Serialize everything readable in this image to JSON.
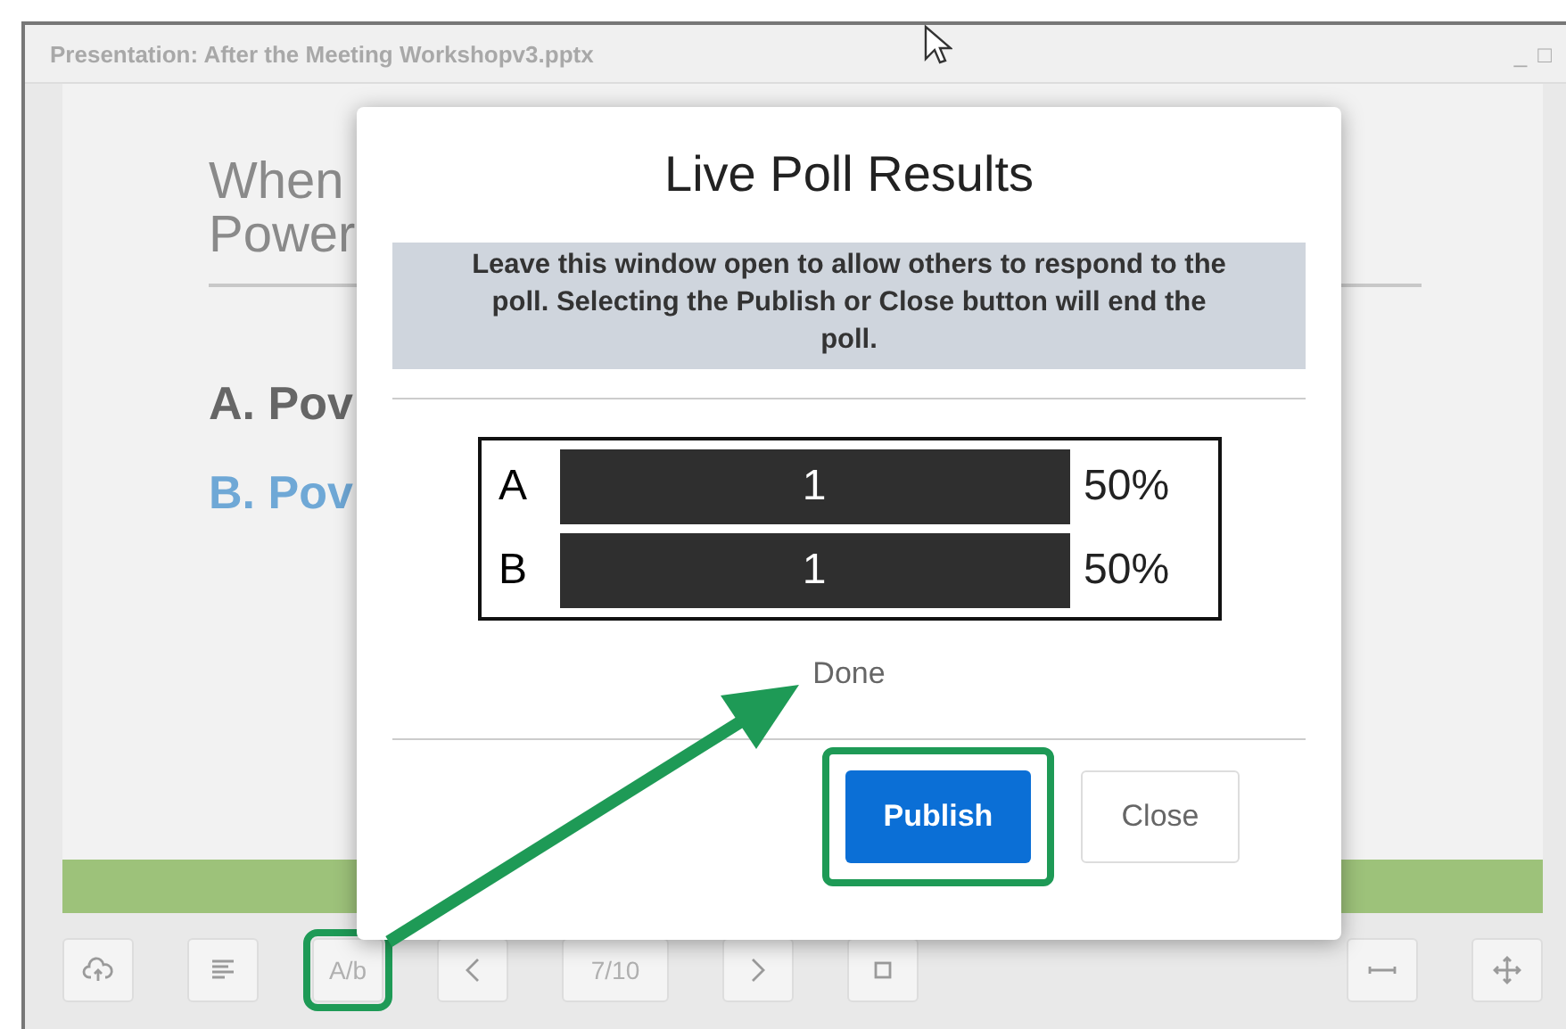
{
  "window": {
    "title": "Presentation: After the Meeting Workshopv3.pptx",
    "controls": [
      "_",
      "□"
    ]
  },
  "slide": {
    "title_lines": [
      "When",
      "Power"
    ],
    "options": [
      {
        "text": "A. Pov",
        "selected": false
      },
      {
        "text": "B. Pov",
        "selected": true
      }
    ]
  },
  "toolbar": {
    "items": [
      {
        "kind": "icon"
      },
      {
        "kind": "icon"
      },
      {
        "kind": "text",
        "text": "A/b",
        "highlighted": true
      },
      {
        "kind": "icon"
      },
      {
        "kind": "text",
        "text": "7/10",
        "highlighted": false
      },
      {
        "kind": "icon"
      },
      {
        "kind": "icon"
      },
      {
        "kind": "gap"
      },
      {
        "kind": "icon"
      },
      {
        "kind": "icon"
      }
    ]
  },
  "dialog": {
    "title": "Live Poll Results",
    "notice": "Leave this window open to allow others to respond to the poll. Selecting the Publish or Close button will end the poll.",
    "results": [
      {
        "label": "A",
        "count": "1",
        "percent": "50%"
      },
      {
        "label": "B",
        "count": "1",
        "percent": "50%"
      }
    ],
    "status": "Done",
    "buttons": [
      {
        "label": "Publish",
        "kind": "primary",
        "highlighted": true
      },
      {
        "label": "Close",
        "kind": "secondary",
        "highlighted": false
      }
    ]
  }
}
